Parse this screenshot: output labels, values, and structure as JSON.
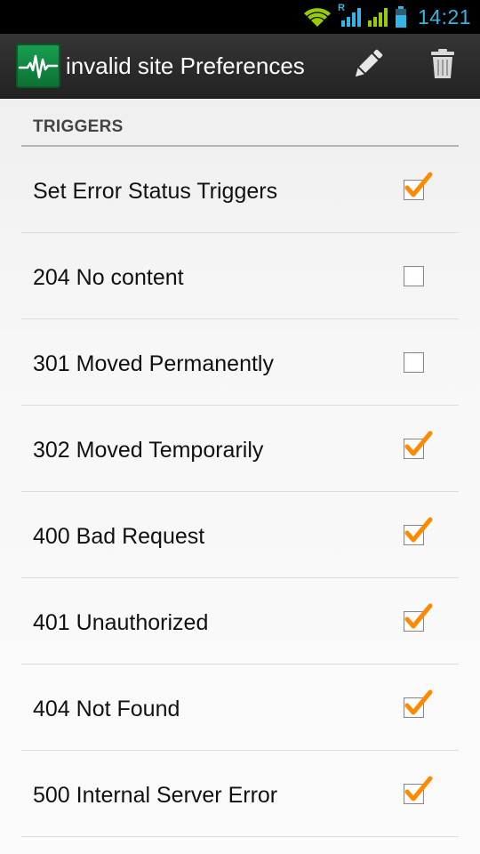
{
  "status_bar": {
    "time": "14:21",
    "roaming_label": "R",
    "icons": [
      "wifi-icon",
      "signal-roaming-icon",
      "signal-icon",
      "battery-icon"
    ]
  },
  "action_bar": {
    "title": "invalid site Preferences",
    "actions": [
      "edit-pencil-icon",
      "trash-icon"
    ]
  },
  "section": {
    "title": "TRIGGERS"
  },
  "preferences": [
    {
      "label": "Set Error Status Triggers",
      "checked": true
    },
    {
      "label": "204 No content",
      "checked": false
    },
    {
      "label": "301 Moved Permanently",
      "checked": false
    },
    {
      "label": "302 Moved Temporarily",
      "checked": true
    },
    {
      "label": "400 Bad Request",
      "checked": true
    },
    {
      "label": "401 Unauthorized",
      "checked": true
    },
    {
      "label": "404 Not Found",
      "checked": true
    },
    {
      "label": "500 Internal Server Error",
      "checked": true
    }
  ],
  "colors": {
    "accent_check": "#ff8a00",
    "status_blue": "#33b5e5",
    "signal_green": "#99cc00",
    "logo_green": "#19a052"
  }
}
